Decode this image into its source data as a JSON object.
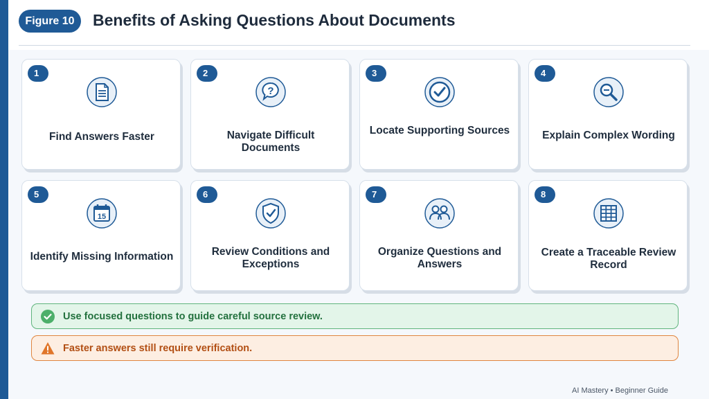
{
  "header": {
    "figure_label": "Figure 10",
    "title": "Benefits of Asking Questions About Documents"
  },
  "cards": [
    {
      "number": "1",
      "label": "Find Answers Faster",
      "icon": "document-icon"
    },
    {
      "number": "2",
      "label": "Navigate Difficult Documents",
      "icon": "question-bubble-icon"
    },
    {
      "number": "3",
      "label": "Locate Supporting Sources",
      "icon": "check-circle-icon"
    },
    {
      "number": "4",
      "label": "Explain Complex Wording",
      "icon": "magnifier-icon"
    },
    {
      "number": "5",
      "label": "Identify Missing Information",
      "icon": "calendar-icon",
      "icon_text": "15"
    },
    {
      "number": "6",
      "label": "Review Conditions and Exceptions",
      "icon": "shield-check-icon"
    },
    {
      "number": "7",
      "label": "Organize Questions and Answers",
      "icon": "people-icon"
    },
    {
      "number": "8",
      "label": "Create a Traceable Review Record",
      "icon": "grid-table-icon"
    }
  ],
  "notes": {
    "success": "Use focused questions to guide careful source review.",
    "warning": "Faster answers still require verification."
  },
  "footer": "AI Mastery • Beginner Guide",
  "colors": {
    "accent": "#1f5a96",
    "success": "#4caf6a",
    "warning": "#e0762a"
  }
}
